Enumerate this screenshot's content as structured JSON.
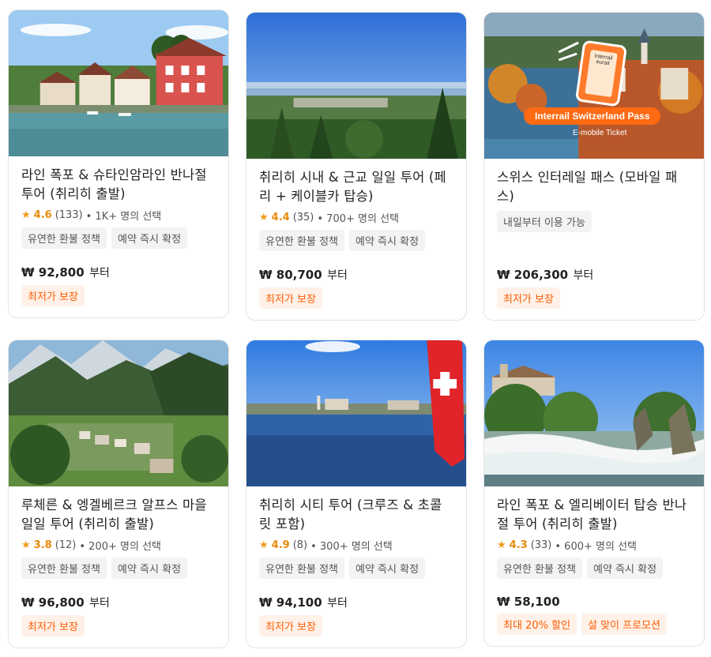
{
  "cards": [
    {
      "title": "라인 폭포 & 슈타인암라인 반나절 투어 (취리히 출발)",
      "rating": "4.6",
      "reviews": "(133)",
      "booked": "• 1K+ 명의 선택",
      "tags": [
        "유연한 환불 정책",
        "예약 즉시 확정"
      ],
      "price": "₩ 92,800",
      "price_suffix": "부터",
      "promos": [
        "최저가 보장"
      ],
      "image": "stein-am-rhein-riverside-village"
    },
    {
      "title": "취리히 시내 & 근교 일일 투어 (페리 + 케이블카 탑승)",
      "rating": "4.4",
      "reviews": "(35)",
      "booked": "• 700+ 명의 선택",
      "tags": [
        "유연한 환불 정책",
        "예약 즉시 확정"
      ],
      "price": "₩ 80,700",
      "price_suffix": "부터",
      "promos": [
        "최저가 보장"
      ],
      "image": "zurich-lake-panorama"
    },
    {
      "title": "스위스 인터레일 패스 (모바일 패스)",
      "rating": "",
      "reviews": "",
      "booked": "",
      "tags": [
        "내일부터 이용 가능"
      ],
      "price": "₩ 206,300",
      "price_suffix": "부터",
      "promos": [
        "최저가 보장"
      ],
      "image": "interrail-pass-promo",
      "pass_badge": "Interrail Switzerland Pass",
      "pass_sub": "E-mobile Ticket",
      "phone_text": "Interrail eurail"
    },
    {
      "title": "루체른 & 엥겔베르크 알프스 마을 일일 투어 (취리히 출발)",
      "rating": "3.8",
      "reviews": "(12)",
      "booked": "• 200+ 명의 선택",
      "tags": [
        "유연한 환불 정책",
        "예약 즉시 확정"
      ],
      "price": "₩ 96,800",
      "price_suffix": "부터",
      "promos": [
        "최저가 보장"
      ],
      "image": "engelberg-alpine-valley"
    },
    {
      "title": "취리히 시티 투어 (크루즈 & 초콜릿 포함)",
      "rating": "4.9",
      "reviews": "(8)",
      "booked": "• 300+ 명의 선택",
      "tags": [
        "유연한 환불 정책",
        "예약 즉시 확정"
      ],
      "price": "₩ 94,100",
      "price_suffix": "부터",
      "promos": [
        "최저가 보장"
      ],
      "image": "zurich-river-swiss-flag"
    },
    {
      "title": "라인 폭포 & 엘리베이터 탑승 반나절 투어 (취리히 출발)",
      "rating": "4.3",
      "reviews": "(33)",
      "booked": "• 600+ 명의 선택",
      "tags": [
        "유연한 환불 정책",
        "예약 즉시 확정"
      ],
      "price": "₩ 58,100",
      "price_suffix": "",
      "promos": [
        "최대 20% 할인",
        "설 맞이 프로모션"
      ],
      "image": "rhine-falls-castle"
    }
  ],
  "icons": {
    "rating_star": "star-icon"
  },
  "colors": {
    "promo_text": "#ff5b00",
    "promo_bg": "#fff1e8",
    "rating": "#e8890c",
    "tag_bg": "#f3f3f3"
  }
}
